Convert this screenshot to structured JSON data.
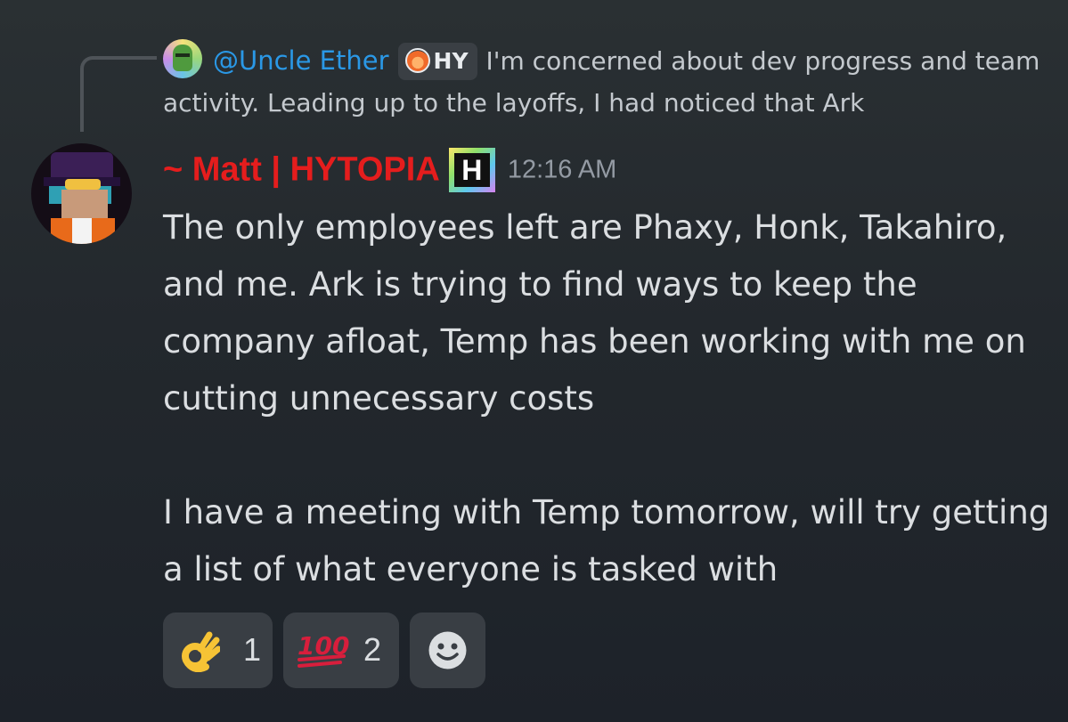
{
  "reply": {
    "username": "@Uncle Ether",
    "tag": "HY",
    "text": "I'm concerned about dev progress and team activity. Leading up to the layoffs, I had noticed that Ark"
  },
  "message": {
    "author": "~ Matt | HYTOPIA",
    "role_icon_letter": "H",
    "timestamp": "12:16 AM",
    "paragraph1": "The only employees left are Phaxy, Honk, Takahiro, and me. Ark is trying to find ways to keep the company afloat, Temp has been working with me on cutting unnecessary costs",
    "paragraph2": "I have a meeting with Temp tomorrow, will try getting a list of what everyone is tasked with"
  },
  "reactions": [
    {
      "emoji": "ok-hand-emoji",
      "count": "1"
    },
    {
      "emoji": "hundred-points-emoji",
      "count": "2"
    }
  ],
  "colors": {
    "author": "#e51d1d",
    "mention": "#2a98e6",
    "timestamp": "#949ba4",
    "text": "#dbdee1"
  }
}
